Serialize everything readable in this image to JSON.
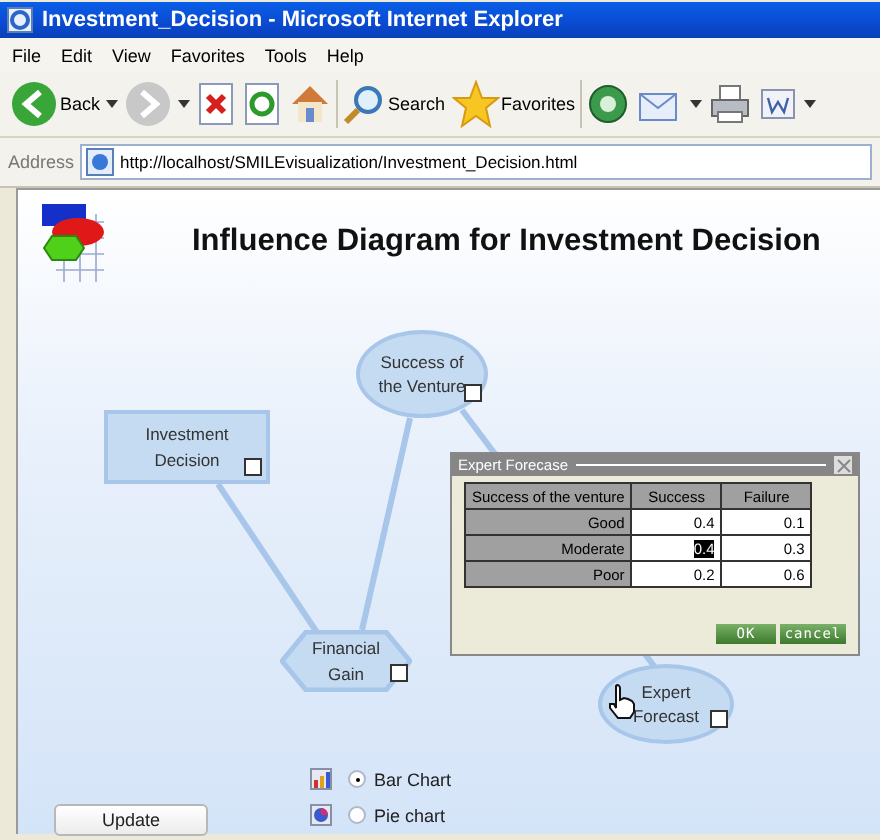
{
  "window": {
    "title": "Investment_Decision - Microsoft Internet Explorer"
  },
  "menu": [
    "File",
    "Edit",
    "View",
    "Favorites",
    "Tools",
    "Help"
  ],
  "toolbar": [
    {
      "kind": "back",
      "label": "Back",
      "disabled": false
    },
    {
      "kind": "forward",
      "disabled": true
    },
    {
      "kind": "stop"
    },
    {
      "kind": "refresh"
    },
    {
      "kind": "home"
    },
    {
      "kind": "search",
      "label": "Search"
    },
    {
      "kind": "favorites",
      "label": "Favorites"
    },
    {
      "kind": "media"
    },
    {
      "kind": "mail"
    },
    {
      "kind": "print"
    },
    {
      "kind": "edit"
    }
  ],
  "address": {
    "label": "Address",
    "url": "http://localhost/SMILEvisualization/Investment_Decision.html"
  },
  "page": {
    "title": "Influence Diagram for Investment Decision"
  },
  "nodes": [
    {
      "kind": "chance",
      "label": "Success of the Venture",
      "checked": false
    },
    {
      "kind": "decision",
      "label": "Investment Decision",
      "checked": false
    },
    {
      "kind": "utility",
      "label": "Financial Gain",
      "checked": false
    },
    {
      "kind": "chance",
      "label": "Expert Forecast",
      "checked": false
    }
  ],
  "dialog": {
    "title": "Expert Forecase",
    "columns": [
      "Success of the venture",
      "Success",
      "Failure"
    ],
    "rows": [
      {
        "cells": [
          {
            "text": "Good",
            "selected": false
          },
          {
            "text": "0.4",
            "selected": false
          },
          {
            "text": "0.1",
            "selected": false
          }
        ]
      },
      {
        "cells": [
          {
            "text": "Moderate",
            "selected": false
          },
          {
            "text": "0.4",
            "selected": true
          },
          {
            "text": "0.3",
            "selected": false
          }
        ]
      },
      {
        "cells": [
          {
            "text": "Poor",
            "selected": false
          },
          {
            "text": "0.2",
            "selected": false
          },
          {
            "text": "0.6",
            "selected": false
          }
        ]
      }
    ],
    "buttons": [
      "OK",
      "cancel"
    ]
  },
  "chart_options": [
    {
      "kind": "bar",
      "label": "Bar Chart",
      "selected": true
    },
    {
      "kind": "pie",
      "label": "Pie chart",
      "selected": false
    }
  ],
  "update_button": "Update"
}
